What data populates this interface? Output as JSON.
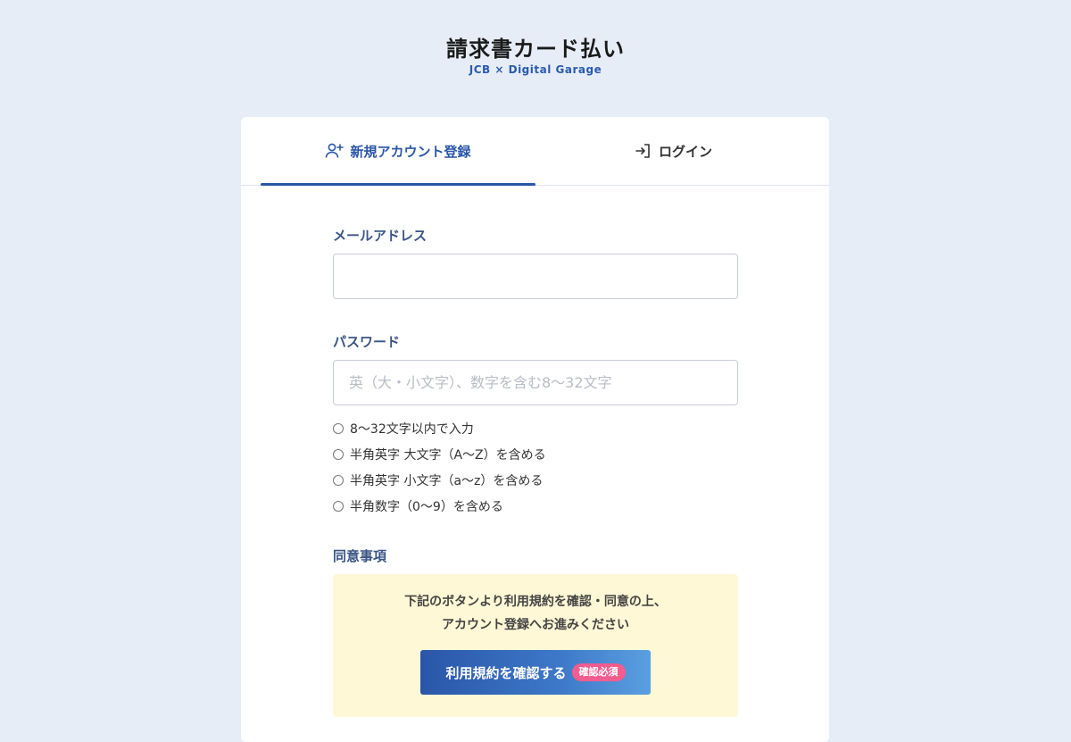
{
  "logo": {
    "title": "請求書カード払い",
    "subtitle": "JCB × Digital Garage"
  },
  "tabs": {
    "signup": "新規アカウント登録",
    "login": "ログイン"
  },
  "email": {
    "label": "メールアドレス",
    "value": ""
  },
  "password": {
    "label": "パスワード",
    "placeholder": "英（大・小文字）、数字を含む8〜32文字"
  },
  "password_rules": [
    "8〜32文字以内で入力",
    "半角英字 大文字（A〜Z）を含める",
    "半角英字 小文字（a〜z）を含める",
    "半角数字（0〜9）を含める"
  ],
  "agreement": {
    "label": "同意事項",
    "text_line1": "下記のボタンより利用規約を確認・同意の上、",
    "text_line2": "アカウント登録へお進みください",
    "button": "利用規約を確認する",
    "badge": "確認必須"
  },
  "colors": {
    "accent": "#2a56a8",
    "background": "#e7edf7",
    "consent_bg": "#fff8d6",
    "badge": "#f25c8e"
  }
}
